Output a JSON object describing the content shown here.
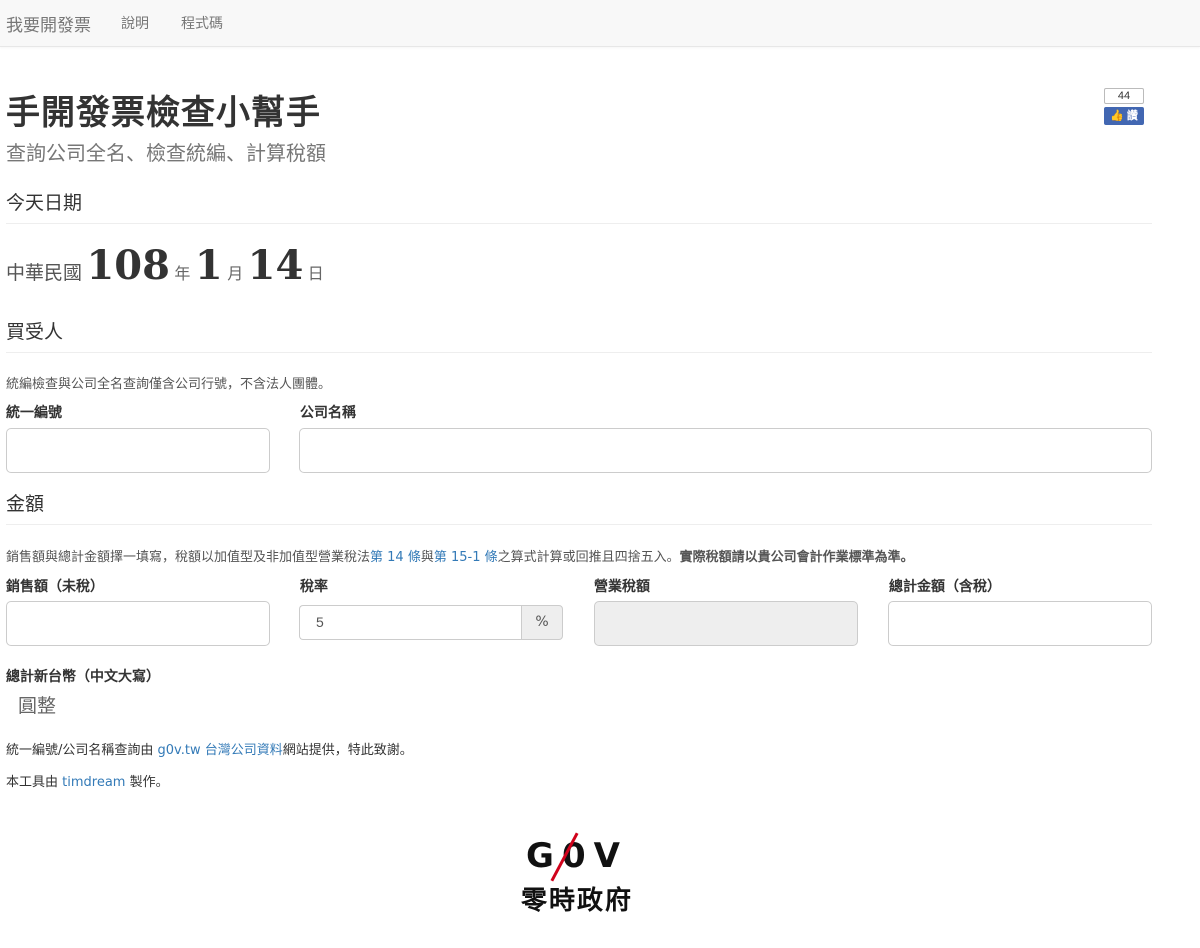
{
  "navbar": {
    "brand": "我要開發票",
    "links": [
      "說明",
      "程式碼"
    ]
  },
  "fb_like": {
    "count": "44",
    "label": "讚"
  },
  "header": {
    "title": "手開發票檢查小幫手",
    "subtitle": "查詢公司全名、檢查統編、計算稅額"
  },
  "today": {
    "heading": "今天日期",
    "era_label": "中華民國",
    "year": "108",
    "year_unit": "年",
    "month": "1",
    "month_unit": "月",
    "day": "14",
    "day_unit": "日"
  },
  "buyer": {
    "heading": "買受人",
    "help": "統編檢查與公司全名查詢僅含公司行號，不含法人團體。",
    "tax_id_label": "統一編號",
    "tax_id_value": "",
    "company_label": "公司名稱",
    "company_value": ""
  },
  "amount": {
    "heading": "金額",
    "help_part1": "銷售額與總計金額擇一填寫，稅額以加值型及非加值型營業稅法",
    "help_link1": "第 14 條",
    "help_part2": "與",
    "help_link2": "第 15-1 條",
    "help_part3": "之算式計算或回推且四捨五入。",
    "help_bold": "實際稅額請以貴公司會計作業標準為準。",
    "sales_label": "銷售額（未稅）",
    "sales_value": "",
    "rate_label": "稅率",
    "rate_value": "5",
    "rate_unit": "%",
    "tax_label": "營業稅額",
    "tax_value": "",
    "total_label": "總計金額（含稅）",
    "total_value": "",
    "total_cn_label": "總計新台幣（中文大寫）",
    "total_cn_value": "圓整"
  },
  "footer": {
    "line1_part1": "統一編號/公司名稱查詢由 ",
    "line1_link": "g0v.tw 台灣公司資料",
    "line1_part2": "網站提供，特此致謝。",
    "line2_part1": "本工具由 ",
    "line2_link": "timdream",
    "line2_part2": " 製作。"
  },
  "logo": {
    "mark": "G0V",
    "text": "零時政府"
  },
  "colors": {
    "link": "#337ab7",
    "fb_blue": "#4267b2",
    "g0v_red": "#d0021b"
  }
}
